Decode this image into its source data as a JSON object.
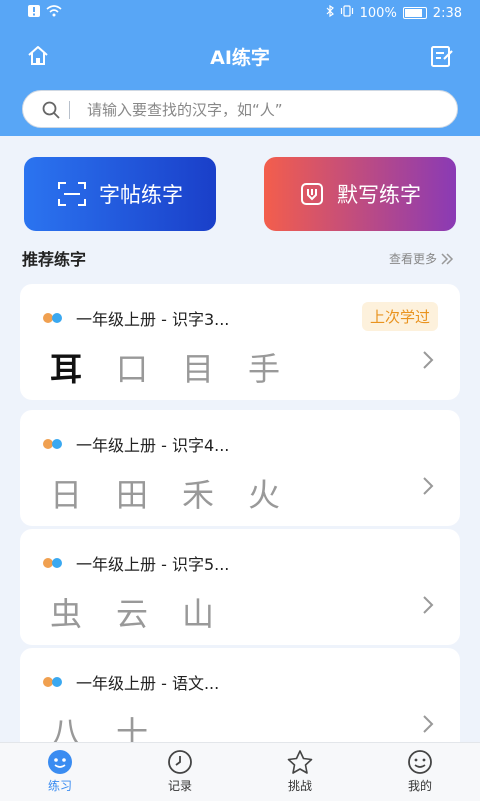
{
  "status": {
    "battery": "100%",
    "time": "2:38"
  },
  "header": {
    "title": "AI练字"
  },
  "search": {
    "placeholder": "请输入要查找的汉字，如“人”"
  },
  "actions": {
    "copybook": "字帖练字",
    "dictation": "默写练字"
  },
  "section": {
    "title": "推荐练字",
    "more": "查看更多"
  },
  "cards": [
    {
      "title": "一年级上册 - 识字3...",
      "badge": "上次学过",
      "chars": [
        "耳",
        "口",
        "目",
        "手"
      ]
    },
    {
      "title": "一年级上册 - 识字4...",
      "chars": [
        "日",
        "田",
        "禾",
        "火"
      ]
    },
    {
      "title": "一年级上册 - 识字5...",
      "chars": [
        "虫",
        "云",
        "山"
      ]
    },
    {
      "title": "一年级上册 - 语文...",
      "chars": [
        "八",
        "十"
      ]
    }
  ],
  "nav": [
    {
      "label": "练习",
      "icon": "practice-icon"
    },
    {
      "label": "记录",
      "icon": "clock-icon"
    },
    {
      "label": "挑战",
      "icon": "star-icon"
    },
    {
      "label": "我的",
      "icon": "smile-icon"
    }
  ],
  "colors": {
    "header": "#58a6f6",
    "active": "#3a8cf1",
    "badge_text": "#e9931f"
  }
}
